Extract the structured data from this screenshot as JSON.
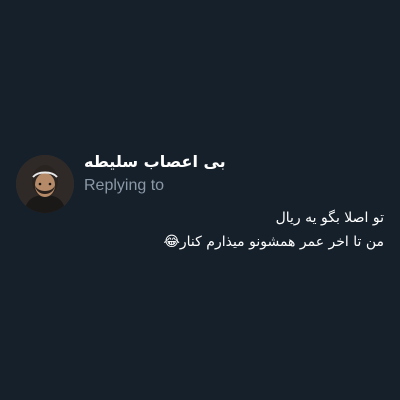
{
  "tweet": {
    "author": {
      "display_name": "بی اعصاب سلیطه",
      "avatar_icon": "profile-photo"
    },
    "replying_to_label": "Replying to",
    "text_lines": [
      "تو اصلا بگو یه ریال",
      "من تا اخر عمر همشونو میذارم کنار😂"
    ]
  },
  "colors": {
    "background": "#15202b",
    "text_primary": "#ffffff",
    "text_secondary": "#8b98a5"
  }
}
